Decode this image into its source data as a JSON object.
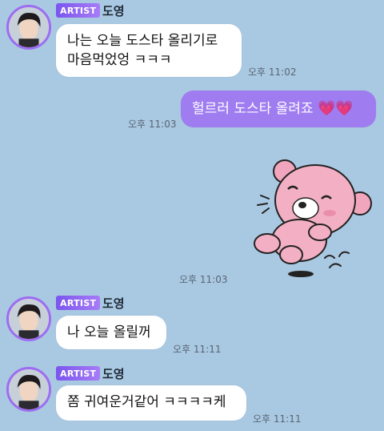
{
  "messages": [
    {
      "type": "incoming",
      "badge": "ARTIST",
      "sender": "도영",
      "lines": [
        "나는 오늘 도스타 올리기로",
        "마음먹었엉 ㅋㅋㅋ"
      ],
      "time": "오후 11:02"
    },
    {
      "type": "outgoing",
      "text": "헐르러 도스타 올려죠",
      "emoji": "💗💗",
      "time": "오후 11:03"
    },
    {
      "type": "sticker",
      "sticker": "pink-bear-sticker",
      "time": "오후 11:03"
    },
    {
      "type": "incoming",
      "badge": "ARTIST",
      "sender": "도영",
      "text": "나 오늘 올릴꺼",
      "time": "오후 11:11"
    },
    {
      "type": "incoming",
      "badge": "ARTIST",
      "sender": "도영",
      "text": "쫌 귀여운거같어 ㅋㅋㅋㅋ케",
      "time": "오후 11:11"
    }
  ],
  "colors": {
    "background": "#a9c8e2",
    "outgoing_bubble": "#9f7cf0",
    "artist_badge": "#8a63f2"
  }
}
